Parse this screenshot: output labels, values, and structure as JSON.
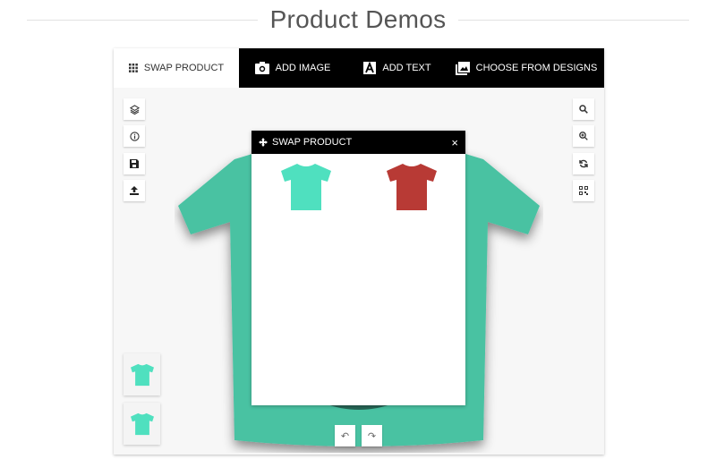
{
  "page": {
    "title": "Product Demos"
  },
  "tabs": [
    {
      "label": "SWAP PRODUCT",
      "icon": "grid-icon",
      "active": true
    },
    {
      "label": "ADD IMAGE",
      "icon": "camera-icon"
    },
    {
      "label": "ADD TEXT",
      "icon": "text-icon"
    },
    {
      "label": "CHOOSE FROM DESIGNS",
      "icon": "images-icon"
    }
  ],
  "left_tools": [
    "layers-icon",
    "info-icon",
    "save-icon",
    "upload-icon"
  ],
  "right_tools": [
    "search-icon",
    "zoom-in-icon",
    "refresh-icon",
    "qr-code-icon"
  ],
  "panel": {
    "title": "SWAP PRODUCT",
    "close": "×",
    "products": [
      {
        "color": "#4fe0bf",
        "name": "teal"
      },
      {
        "color": "#b83a35",
        "name": "red"
      }
    ]
  },
  "shirt_color": "#48c2a2",
  "views": [
    "front",
    "back"
  ],
  "history": {
    "undo": "↶",
    "redo": "↷"
  }
}
